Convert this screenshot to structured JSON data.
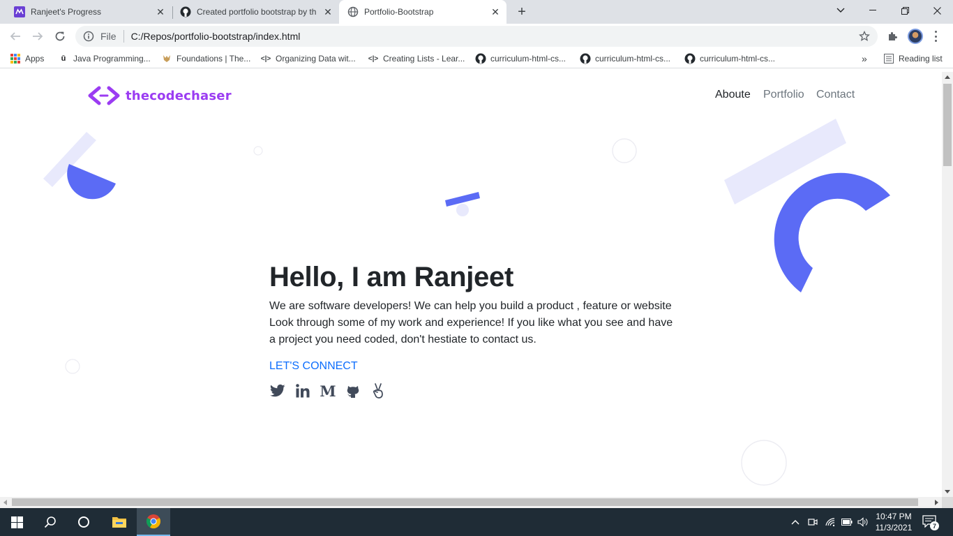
{
  "browser": {
    "tabs": [
      {
        "title": "Ranjeet's Progress",
        "icon": "ranjeet-progress-favicon"
      },
      {
        "title": "Created portfolio bootstrap by th",
        "icon": "github-icon"
      },
      {
        "title": "Portfolio-Bootstrap",
        "icon": "globe-icon"
      }
    ],
    "address": {
      "scheme_label": "File",
      "url": "C:/Repos/portfolio-bootstrap/index.html"
    },
    "bookmarks": [
      {
        "label": "Apps",
        "icon": "apps-grid-icon"
      },
      {
        "label": "Java Programming...",
        "icon": "udemy-icon"
      },
      {
        "label": "Foundations | The...",
        "icon": "odin-project-icon"
      },
      {
        "label": "Organizing Data wit...",
        "icon": "code-icon"
      },
      {
        "label": "Creating Lists - Lear...",
        "icon": "code-icon"
      },
      {
        "label": "curriculum-html-cs...",
        "icon": "github-icon"
      },
      {
        "label": "curriculum-html-cs...",
        "icon": "github-icon"
      },
      {
        "label": "curriculum-html-cs...",
        "icon": "github-icon"
      }
    ],
    "more_bookmarks": "»",
    "reading_list": "Reading list"
  },
  "page": {
    "brand": "thecodechaser",
    "nav": [
      "Aboute",
      "Portfolio",
      "Contact"
    ],
    "hero": {
      "heading": "Hello, I am Ranjeet",
      "intro": "We are software developers! We can help you build a product , feature or website Look through some of my work and experience! If you like what you see and have a project you need coded, don't hestiate to contact us.",
      "cta": "LET'S CONNECT"
    },
    "socials": [
      "twitter-icon",
      "linkedin-icon",
      "medium-icon",
      "github-icon",
      "angellist-icon"
    ],
    "colors": {
      "brand": "#9b3cf2",
      "shape_blue": "#5b6bf5",
      "shape_light": "#e7e8fb",
      "link": "#0d6efd"
    }
  },
  "taskbar": {
    "time": "10:47 PM",
    "date": "11/3/2021",
    "notification_count": "7"
  }
}
